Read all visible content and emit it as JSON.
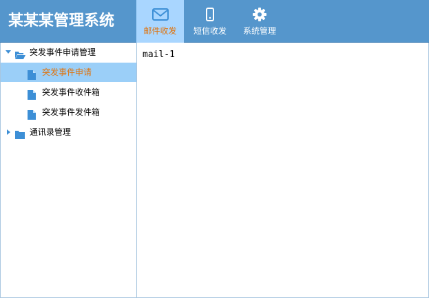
{
  "header": {
    "app_title": "某某某管理系统",
    "tabs": [
      {
        "label": "邮件收发",
        "icon": "envelope-icon",
        "active": true
      },
      {
        "label": "短信收发",
        "icon": "mobile-phone-icon",
        "active": false
      },
      {
        "label": "系统管理",
        "icon": "gear-icon",
        "active": false
      }
    ]
  },
  "sidebar": {
    "tree": [
      {
        "label": "突发事件申请管理",
        "icon": "folder-open-icon",
        "expanded": true,
        "level": 0
      },
      {
        "label": "突发事件申请",
        "icon": "file-icon",
        "selected": true,
        "level": 1
      },
      {
        "label": "突发事件收件箱",
        "icon": "file-icon",
        "selected": false,
        "level": 1
      },
      {
        "label": "突发事件发件箱",
        "icon": "file-icon",
        "selected": false,
        "level": 1
      },
      {
        "label": "通讯录管理",
        "icon": "folder-icon",
        "expanded": false,
        "level": 0
      }
    ]
  },
  "content": {
    "text": "mail-1"
  },
  "colors": {
    "header_bg": "#5596cc",
    "active_tab_bg": "#a9d6ff",
    "selected_row_bg": "#9bcff8",
    "accent_text": "#e0720a",
    "icon_blue": "#3d8fd6"
  }
}
